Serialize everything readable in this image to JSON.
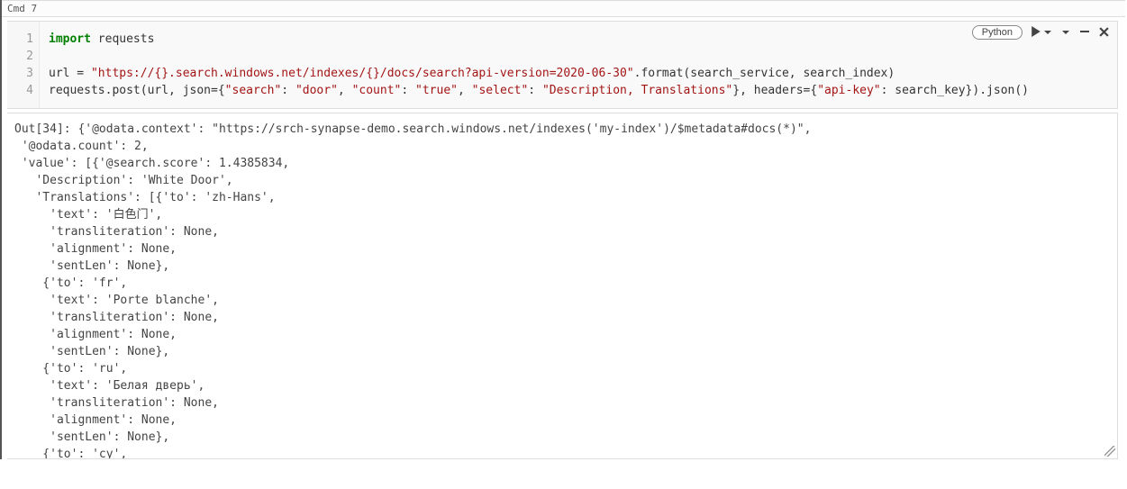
{
  "cell": {
    "label": "Cmd 7",
    "kernel": "Python",
    "line_numbers": [
      "1",
      "2",
      "3",
      "4"
    ],
    "code": {
      "l1_kw": "import",
      "l1_mod": " requests",
      "l2": "",
      "l3_a": "url = ",
      "l3_str": "\"https://{}.search.windows.net/indexes/{}/docs/search?api-version=2020-06-30\"",
      "l3_b": ".format(search_service, search_index)",
      "l4_a": "requests.post(url, json={",
      "l4_k1": "\"search\"",
      "l4_c1": ": ",
      "l4_v1": "\"door\"",
      "l4_c2": ", ",
      "l4_k2": "\"count\"",
      "l4_c3": ": ",
      "l4_v2": "\"true\"",
      "l4_c4": ", ",
      "l4_k3": "\"select\"",
      "l4_c5": ": ",
      "l4_v3": "\"Description, Translations\"",
      "l4_b": "}, headers={",
      "l4_k4": "\"api-key\"",
      "l4_c6": ": search_key}).json()"
    },
    "output_prefix": "Out[34]: ",
    "output_body": "{'@odata.context': \"https://srch-synapse-demo.search.windows.net/indexes('my-index')/$metadata#docs(*)\",\n '@odata.count': 2,\n 'value': [{'@search.score': 1.4385834,\n   'Description': 'White Door',\n   'Translations': [{'to': 'zh-Hans',\n     'text': '白色门',\n     'transliteration': None,\n     'alignment': None,\n     'sentLen': None},\n    {'to': 'fr',\n     'text': 'Porte blanche',\n     'transliteration': None,\n     'alignment': None,\n     'sentLen': None},\n    {'to': 'ru',\n     'text': 'Белая дверь',\n     'transliteration': None,\n     'alignment': None,\n     'sentLen': None},\n    {'to': 'cy',\n     'text': 'Drws Gwyn',"
  }
}
